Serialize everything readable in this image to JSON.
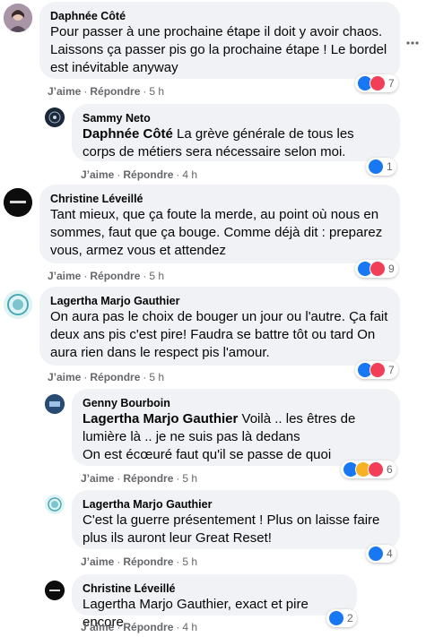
{
  "actions": {
    "like": "J’aime",
    "reply": "Répondre"
  },
  "comments": [
    {
      "name": "Daphnée Côté",
      "text": "Pour passer à une prochaine étape il doit y avoir chaos. Laissons ça passer pis go la prochaine étape ! Le bordel est inévitable anyway",
      "time": "5 h",
      "reactions": "7"
    },
    {
      "name": "Sammy Neto",
      "mention": "Daphnée Côté",
      "text": " La grève générale de tous les corps de métiers sera nécessaire selon moi.",
      "time": "4 h",
      "reactions": "1"
    },
    {
      "name": "Christine Léveillé",
      "text": "Tant mieux, que ça foute la merde, au point où nous en sommes, faut que ça bouge. Comme déjà dit : preparez vous, armez vous et attendez",
      "time": "5 h",
      "reactions": "9"
    },
    {
      "name": "Lagertha Marjo Gauthier",
      "text": "On aura pas le choix de bouger un jour ou l'autre. Ça fait deux ans pis c'est pire! Faudra se battre tôt ou tard On aura rien dans le respect pis l'amour.",
      "time": "5 h",
      "reactions": "7"
    },
    {
      "name": "Genny Bourboin",
      "mention": "Lagertha Marjo Gauthier",
      "text": " Voilà .. les êtres de lumière là .. je ne suis pas là dedans",
      "text2": "On est écœuré faut qu'il se passe de quoi",
      "time": "5 h",
      "reactions": "6"
    },
    {
      "name": "Lagertha Marjo Gauthier",
      "text": "C'est la guerre présentement ! Plus on laisse faire plus ils auront leur Great Reset!",
      "time": "5 h",
      "reactions": "4"
    },
    {
      "name": "Christine Léveillé",
      "text": "Lagertha Marjo Gauthier, exact et pire encore",
      "time": "4 h",
      "reactions": "2"
    }
  ],
  "icons": {
    "more": "more-options-icon",
    "like": "like-reaction-icon",
    "love": "love-reaction-icon",
    "haha": "haha-reaction-icon"
  },
  "colors": {
    "bubble": "#f0f2f5",
    "like": "#1877f2",
    "love": "#f33e58",
    "meta": "#65676b"
  }
}
